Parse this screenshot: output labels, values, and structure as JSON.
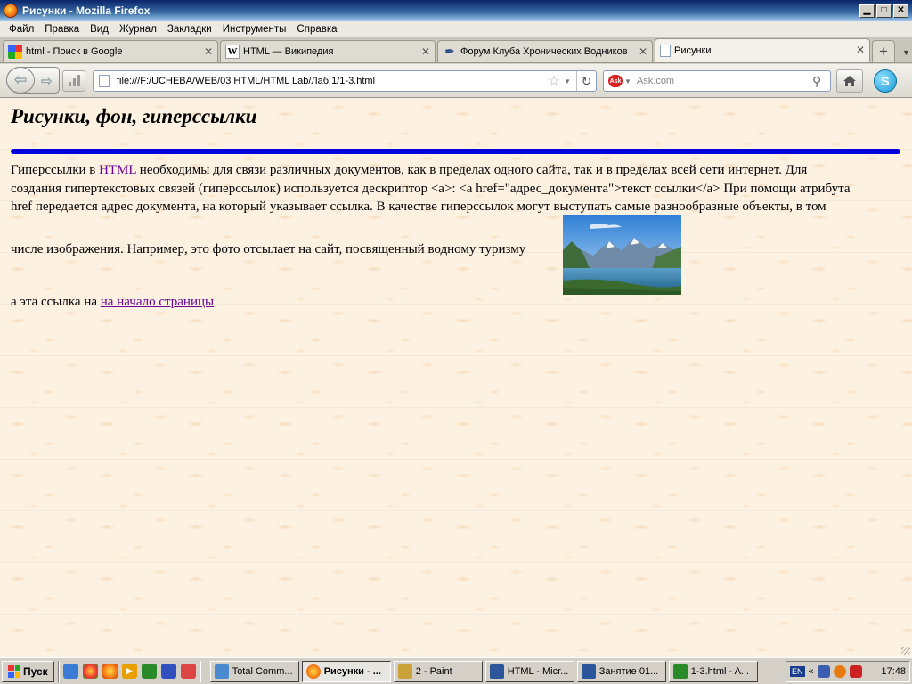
{
  "window": {
    "title": "Рисунки - Mozilla Firefox"
  },
  "menu": [
    "Файл",
    "Правка",
    "Вид",
    "Журнал",
    "Закладки",
    "Инструменты",
    "Справка"
  ],
  "tabs": [
    {
      "label": "html - Поиск в Google",
      "icon": "google-icon",
      "active": false
    },
    {
      "label": "HTML — Википедия",
      "icon": "wikipedia-icon",
      "active": false
    },
    {
      "label": "Форум Клуба Хронических Водников",
      "icon": "feather-icon",
      "active": false
    },
    {
      "label": "Рисунки",
      "icon": "page-icon",
      "active": true
    }
  ],
  "nav": {
    "url": "file:///F:/UCHEBA/WEB/03 HTML/HTML Lab/Лаб 1/1-3.html",
    "search_placeholder": "Ask.com",
    "search_engine": "Ask"
  },
  "page": {
    "heading": "Рисунки, фон, гиперссылки",
    "para_line1_before": "Гиперссылки в ",
    "para_link_html": "HTML ",
    "para_line1_after": "необходимы для связи различных документов, как в пределах одного сайта, так и в пределах всей сети интернет. Для",
    "para_line2": "создания гипертекстовых связей (гиперссылок) используется дескриптор <a>: <a href=\"адрес_документа\">текст ссылки</a> При помощи атрибута",
    "para_line3": "href передается адрес документа, на который указывает ссылка. В качестве гиперссылок могут выступать самые разнообразные объекты, в том",
    "para_line4": "числе изображения. Например, это фото отсылает на сайт, посвященный водному туризму",
    "link_line_prefix": "а эта ссылка на ",
    "link_top": "на начало страницы"
  },
  "taskbar": {
    "start": "Пуск",
    "tasks": [
      {
        "label": "Total Comm...",
        "active": false
      },
      {
        "label": "Рисунки - ...",
        "active": true
      },
      {
        "label": "2 - Paint",
        "active": false
      },
      {
        "label": "HTML - Micr...",
        "active": false
      },
      {
        "label": "Занятие 01...",
        "active": false
      },
      {
        "label": "1-3.html - A...",
        "active": false
      }
    ],
    "lang": "EN",
    "time": "17:48"
  },
  "colors": {
    "link_visited": "#660099",
    "hr_blue": "#0000dd",
    "page_bg": "#fdf1e2"
  }
}
